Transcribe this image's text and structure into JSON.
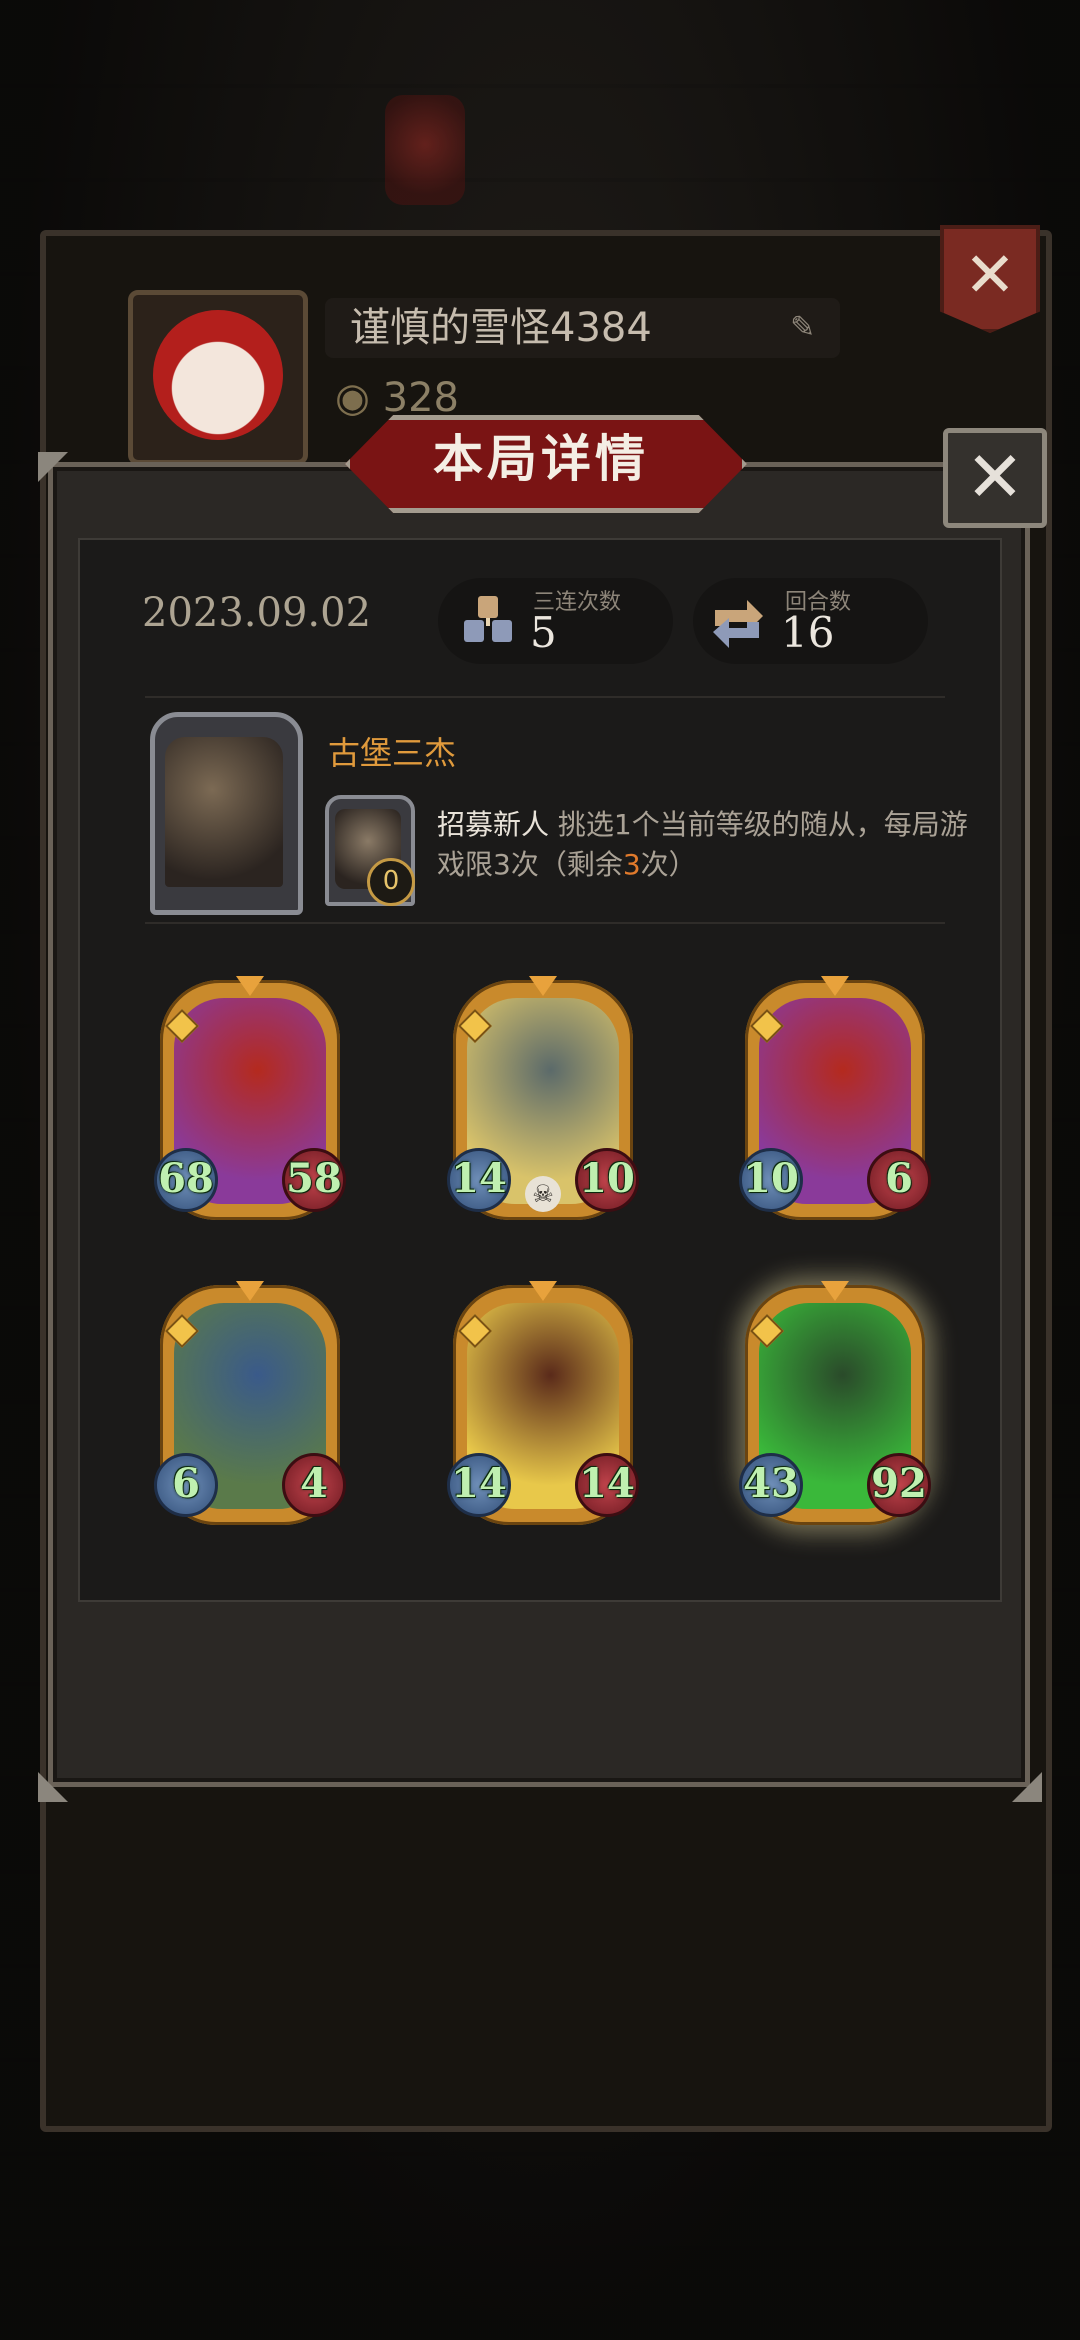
{
  "background": {
    "profile": {
      "name": "谨慎的雪怪4384",
      "coins": "328",
      "close_glyph": "✕",
      "edit_glyph": "✎"
    }
  },
  "dialog": {
    "title": "本局详情",
    "close_glyph": "✕",
    "date": "2023.09.02",
    "stats": [
      {
        "label": "三连次数",
        "value": "5",
        "icon": "triple-merge-icon"
      },
      {
        "label": "回合数",
        "value": "16",
        "icon": "round-cycle-icon"
      }
    ],
    "hero": {
      "name": "古堡三杰",
      "skill_cost": "0",
      "skill_name": "招募新人",
      "skill_desc_a": "挑选1个当前等级的随从，每局游戏限3次（剩余",
      "skill_remaining": "3",
      "skill_desc_b": "次）"
    },
    "minions": [
      {
        "name": "horned-demon",
        "attack": "68",
        "health": "58",
        "colors": [
          "#8a3a9a",
          "#b42a1e"
        ],
        "skull": false,
        "glow": false
      },
      {
        "name": "golden-dragon",
        "attack": "14",
        "health": "10",
        "colors": [
          "#d9c36a",
          "#5b6a6a"
        ],
        "skull": true,
        "glow": false
      },
      {
        "name": "horned-demon",
        "attack": "10",
        "health": "6",
        "colors": [
          "#8a3a9a",
          "#b42a1e"
        ],
        "skull": false,
        "glow": false
      },
      {
        "name": "frog-lady",
        "attack": "6",
        "health": "4",
        "colors": [
          "#5a7a4a",
          "#3a5a8a"
        ],
        "skull": false,
        "glow": false
      },
      {
        "name": "flame-lord",
        "attack": "14",
        "health": "14",
        "colors": [
          "#e8c84a",
          "#5a2a1a"
        ],
        "skull": false,
        "glow": false
      },
      {
        "name": "green-slime-beast",
        "attack": "43",
        "health": "92",
        "colors": [
          "#3ab83a",
          "#2a4a2a"
        ],
        "skull": false,
        "glow": true
      }
    ],
    "accent": "#e09a3c",
    "highlight": "#e07a2c"
  }
}
